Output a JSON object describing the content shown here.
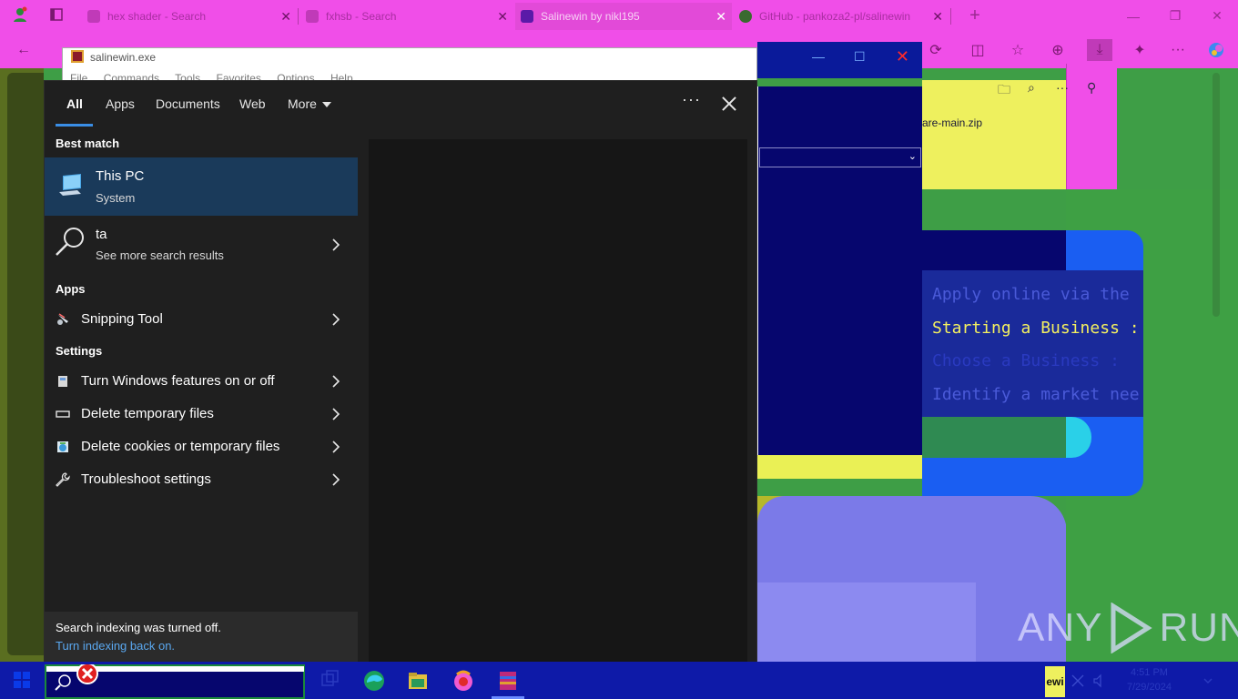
{
  "browser": {
    "tabs": [
      {
        "label": "hex shader - Search",
        "active": false
      },
      {
        "label": "fxhsb - Search",
        "active": false
      },
      {
        "label": "Salinewin by nikl195",
        "active": true
      },
      {
        "label": "GitHub - pankoza2-pl/salinewin",
        "active": false
      }
    ],
    "new_tab": "+",
    "minimize": "—",
    "restore": "❐",
    "close": "✕"
  },
  "salinewin_window": {
    "title": "salinewin.exe",
    "menu": [
      "File",
      "Commands",
      "Tools",
      "Favorites",
      "Options",
      "Help"
    ]
  },
  "download_panel": {
    "filename": "are-main.zip"
  },
  "webpage": {
    "lines": [
      "Apply online via the",
      "Starting a Business :",
      "Choose a Business :",
      "Identify a market nee"
    ]
  },
  "start_search": {
    "tabs": {
      "all": "All",
      "apps": "Apps",
      "documents": "Documents",
      "web": "Web",
      "more": "More"
    },
    "options_label": "···",
    "best_match_heading": "Best match",
    "best_match": {
      "title": "This PC",
      "subtitle": "System"
    },
    "web_result": {
      "title": "ta",
      "subtitle": "See more search results"
    },
    "apps_heading": "Apps",
    "apps": [
      {
        "label": "Snipping Tool",
        "icon": "scissors-icon"
      }
    ],
    "settings_heading": "Settings",
    "settings": [
      {
        "label": "Turn Windows features on or off",
        "icon": "windows-features-icon"
      },
      {
        "label": "Delete temporary files",
        "icon": "storage-icon"
      },
      {
        "label": "Delete cookies or temporary files",
        "icon": "internet-options-icon"
      },
      {
        "label": "Troubleshoot settings",
        "icon": "wrench-icon"
      }
    ],
    "footer": {
      "message": "Search indexing was turned off.",
      "link": "Turn indexing back on."
    }
  },
  "watermark": {
    "left": "ANY",
    "right": "RUN"
  },
  "taskbar": {
    "ewi_label": "ewi",
    "clock_time": "4:51 PM",
    "clock_date": "7/29/2024"
  },
  "colors": {
    "accent": "#3a8ee6",
    "best_match_bg": "#1a3a5a",
    "flyout_bg": "#1f1f1f",
    "link": "#5aa8f0"
  }
}
